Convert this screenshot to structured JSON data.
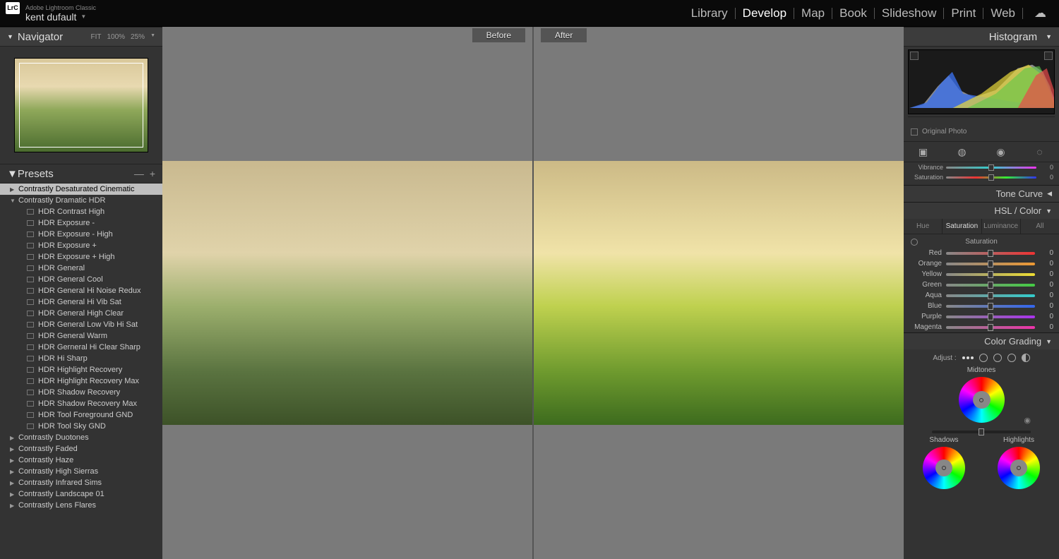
{
  "app": {
    "name": "Adobe Lightroom Classic",
    "user": "kent dufault",
    "logo": "LrC"
  },
  "modules": {
    "items": [
      "Library",
      "Develop",
      "Map",
      "Book",
      "Slideshow",
      "Print",
      "Web"
    ],
    "active": "Develop"
  },
  "navigator": {
    "title": "Navigator",
    "fit": "FIT",
    "p100": "100%",
    "zoom": "25%"
  },
  "presets": {
    "title": "Presets",
    "minus": "—",
    "plus": "+",
    "folders_top": [
      {
        "name": "Contrastly Desaturated Cinematic",
        "open": false,
        "selected": true
      },
      {
        "name": "Contrastly Dramatic HDR",
        "open": true,
        "selected": false
      }
    ],
    "hdr_items": [
      "HDR Contrast High",
      "HDR Exposure -",
      "HDR Exposure - High",
      "HDR Exposure +",
      "HDR Exposure + High",
      "HDR General",
      "HDR General Cool",
      "HDR General Hi Noise Redux",
      "HDR General Hi Vib Sat",
      "HDR General High Clear",
      "HDR General Low Vib Hi Sat",
      "HDR General Warm",
      "HDR Gerneral Hi Clear Sharp",
      "HDR Hi Sharp",
      "HDR Highlight Recovery",
      "HDR Highlight Recovery Max",
      "HDR Shadow Recovery",
      "HDR Shadow Recovery Max",
      "HDR Tool Foreground GND",
      "HDR Tool Sky GND"
    ],
    "folders_bottom": [
      "Contrastly Duotones",
      "Contrastly Faded",
      "Contrastly Haze",
      "Contrastly High Sierras",
      "Contrastly Infrared Sims",
      "Contrastly Landscape 01",
      "Contrastly Lens Flares"
    ]
  },
  "compare": {
    "before": "Before",
    "after": "After"
  },
  "histogram": {
    "title": "Histogram",
    "original": "Original Photo"
  },
  "basic_tail": {
    "vibrance": {
      "label": "Vibrance",
      "value": "0"
    },
    "saturation": {
      "label": "Saturation",
      "value": "0"
    }
  },
  "tone_curve": {
    "title": "Tone Curve"
  },
  "hsl": {
    "title": "HSL / Color",
    "tabs": {
      "hue": "Hue",
      "saturation": "Saturation",
      "luminance": "Luminance",
      "all": "All",
      "active": "Saturation"
    },
    "subtitle": "Saturation",
    "rows": [
      {
        "label": "Red",
        "value": "0",
        "g": "linear-gradient(to right,#888,#e33)"
      },
      {
        "label": "Orange",
        "value": "0",
        "g": "linear-gradient(to right,#888,#e93)"
      },
      {
        "label": "Yellow",
        "value": "0",
        "g": "linear-gradient(to right,#888,#ed3)"
      },
      {
        "label": "Green",
        "value": "0",
        "g": "linear-gradient(to right,#888,#4c4)"
      },
      {
        "label": "Aqua",
        "value": "0",
        "g": "linear-gradient(to right,#888,#3cc)"
      },
      {
        "label": "Blue",
        "value": "0",
        "g": "linear-gradient(to right,#888,#36e)"
      },
      {
        "label": "Purple",
        "value": "0",
        "g": "linear-gradient(to right,#888,#a3e)"
      },
      {
        "label": "Magenta",
        "value": "0",
        "g": "linear-gradient(to right,#888,#e3a)"
      }
    ]
  },
  "color_grading": {
    "title": "Color Grading",
    "adjust": "Adjust :",
    "midtones": "Midtones",
    "shadows": "Shadows",
    "highlights": "Highlights"
  }
}
